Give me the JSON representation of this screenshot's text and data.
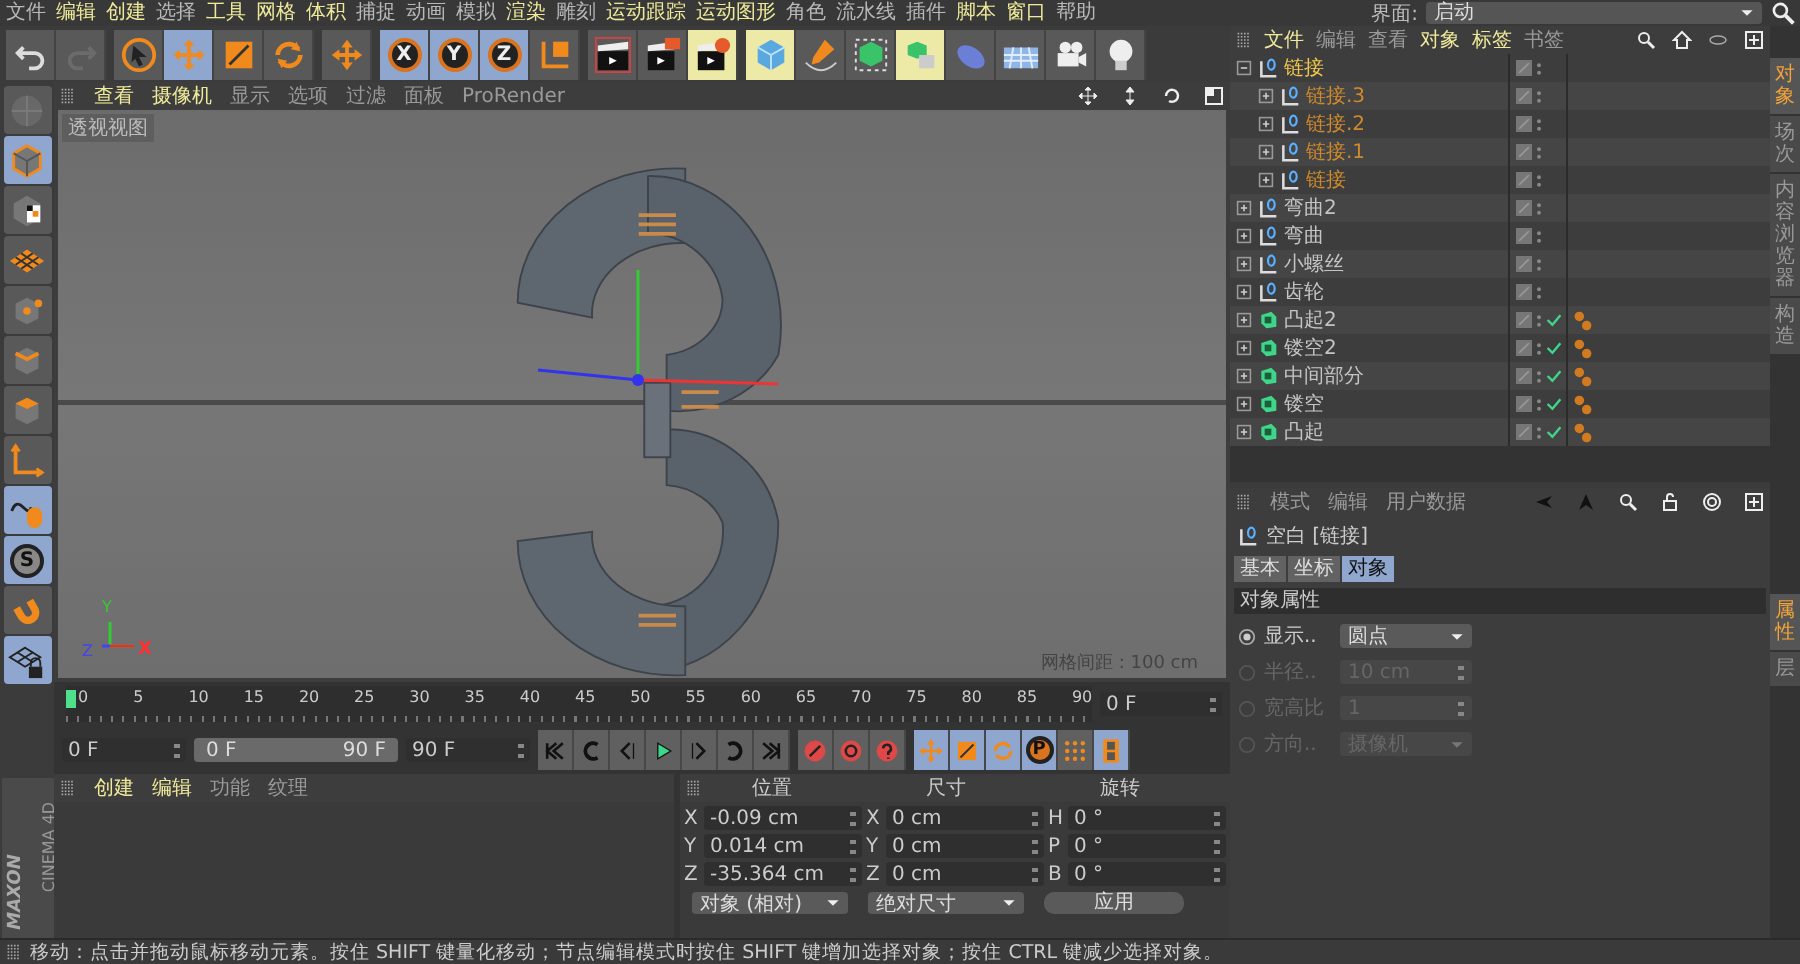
{
  "menu_bar": {
    "items": [
      {
        "label": "文件",
        "highlighted": false
      },
      {
        "label": "编辑",
        "highlighted": true
      },
      {
        "label": "创建",
        "highlighted": true
      },
      {
        "label": "选择",
        "highlighted": false
      },
      {
        "label": "工具",
        "highlighted": true
      },
      {
        "label": "网格",
        "highlighted": true
      },
      {
        "label": "体积",
        "highlighted": true
      },
      {
        "label": "捕捉",
        "highlighted": false
      },
      {
        "label": "动画",
        "highlighted": false
      },
      {
        "label": "模拟",
        "highlighted": false
      },
      {
        "label": "渲染",
        "highlighted": true
      },
      {
        "label": "雕刻",
        "highlighted": false
      },
      {
        "label": "运动跟踪",
        "highlighted": true
      },
      {
        "label": "运动图形",
        "highlighted": true
      },
      {
        "label": "角色",
        "highlighted": false
      },
      {
        "label": "流水线",
        "highlighted": false
      },
      {
        "label": "插件",
        "highlighted": false
      },
      {
        "label": "脚本",
        "highlighted": true
      },
      {
        "label": "窗口",
        "highlighted": true
      },
      {
        "label": "帮助",
        "highlighted": false
      }
    ],
    "interface_label": "界面:",
    "interface_value": "启动"
  },
  "toolbar": {
    "tools": [
      {
        "selected": false,
        "highlighted": false,
        "disabled": false
      },
      {
        "selected": false,
        "highlighted": false,
        "disabled": true
      },
      {
        "selected": false,
        "highlighted": false,
        "disabled": false
      },
      {
        "selected": true,
        "highlighted": false,
        "disabled": false
      },
      {
        "selected": false,
        "highlighted": false,
        "disabled": false
      },
      {
        "selected": false,
        "highlighted": false,
        "disabled": false
      },
      {
        "selected": false,
        "highlighted": false,
        "disabled": false
      },
      {
        "label": "X",
        "selected": true,
        "highlighted": false,
        "disabled": false
      },
      {
        "label": "Y",
        "selected": true,
        "highlighted": false,
        "disabled": false
      },
      {
        "label": "Z",
        "selected": true,
        "highlighted": false,
        "disabled": false
      },
      {
        "selected": false,
        "highlighted": false,
        "disabled": false
      },
      {
        "selected": false,
        "highlighted": false,
        "disabled": false
      },
      {
        "selected": false,
        "highlighted": false,
        "disabled": false
      },
      {
        "selected": false,
        "highlighted": true,
        "disabled": false
      },
      {
        "selected": false,
        "highlighted": true,
        "disabled": false
      },
      {
        "selected": false,
        "highlighted": false,
        "disabled": false
      },
      {
        "selected": false,
        "highlighted": false,
        "disabled": false
      },
      {
        "selected": false,
        "highlighted": true,
        "disabled": false
      },
      {
        "selected": false,
        "highlighted": false,
        "disabled": false
      },
      {
        "selected": false,
        "highlighted": false,
        "disabled": false
      },
      {
        "selected": false,
        "highlighted": false,
        "disabled": false
      },
      {
        "selected": false,
        "highlighted": false,
        "disabled": false
      }
    ]
  },
  "left_tools": [
    {
      "selected": false,
      "disabled": true
    },
    {
      "selected": true,
      "disabled": false
    },
    {
      "selected": false,
      "disabled": false
    },
    {
      "selected": false,
      "disabled": false
    },
    {
      "selected": false,
      "disabled": false
    },
    {
      "selected": false,
      "disabled": false
    },
    {
      "selected": false,
      "disabled": false
    },
    {
      "selected": false,
      "disabled": false
    },
    {
      "selected": true,
      "disabled": false
    },
    {
      "label": "S",
      "selected": true,
      "disabled": false
    },
    {
      "selected": false,
      "disabled": false
    },
    {
      "selected": true,
      "disabled": false
    }
  ],
  "viewport": {
    "menu": [
      {
        "label": "查看",
        "highlighted": true
      },
      {
        "label": "摄像机",
        "highlighted": true
      },
      {
        "label": "显示",
        "highlighted": false
      },
      {
        "label": "选项",
        "highlighted": false
      },
      {
        "label": "过滤",
        "highlighted": false
      },
      {
        "label": "面板",
        "highlighted": false
      },
      {
        "label": "ProRender",
        "highlighted": false
      }
    ],
    "view_name": "透视视图",
    "grid_info": "网格间距 : 100 cm",
    "axis_gizmo": {
      "x": "X",
      "y": "Y",
      "z": "Z"
    }
  },
  "timeline": {
    "ticks": [
      "0",
      "5",
      "10",
      "15",
      "20",
      "25",
      "30",
      "35",
      "40",
      "45",
      "50",
      "55",
      "60",
      "65",
      "70",
      "75",
      "80",
      "85",
      "90"
    ],
    "current_frame": "0 F"
  },
  "playback": {
    "start": "0 F",
    "range_start": "0 F",
    "range_end": "90 F",
    "level": 1,
    "end": "90 F",
    "key_tools": [
      {
        "selected": true
      },
      {
        "selected": true
      },
      {
        "selected": true
      },
      {
        "label": "P",
        "selected": true
      },
      {
        "selected": false
      },
      {
        "selected": true
      }
    ]
  },
  "material_panel": {
    "menu": [
      {
        "label": "创建",
        "highlighted": true
      },
      {
        "label": "编辑",
        "highlighted": true
      },
      {
        "label": "功能",
        "highlighted": false
      },
      {
        "label": "纹理",
        "highlighted": false
      }
    ]
  },
  "coordinates": {
    "headers": [
      "位置",
      "尺寸",
      "旋转"
    ],
    "rows": [
      {
        "position_axis": "X",
        "position": "-0.09 cm",
        "size_axis": "X",
        "size": "0 cm",
        "rotation_axis": "H",
        "rotation": "0 °"
      },
      {
        "position_axis": "Y",
        "position": "0.014 cm",
        "size_axis": "Y",
        "size": "0 cm",
        "rotation_axis": "P",
        "rotation": "0 °"
      },
      {
        "position_axis": "Z",
        "position": "-35.364 cm",
        "size_axis": "Z",
        "size": "0 cm",
        "rotation_axis": "B",
        "rotation": "0 °"
      }
    ],
    "mode": "对象 (相对)",
    "size_mode": "绝对尺寸",
    "apply": "应用"
  },
  "logo": {
    "brand": "MAXON",
    "product": "CINEMA 4D"
  },
  "object_manager": {
    "menu": [
      {
        "label": "文件",
        "highlighted": true
      },
      {
        "label": "编辑",
        "highlighted": false
      },
      {
        "label": "查看",
        "highlighted": false
      },
      {
        "label": "对象",
        "highlighted": true
      },
      {
        "label": "标签",
        "highlighted": true
      },
      {
        "label": "书签",
        "highlighted": false
      }
    ],
    "objects": [
      {
        "name": "链接",
        "kind": "null",
        "selected": true,
        "expanded": true,
        "children": [
          {
            "name": "链接.3",
            "kind": "null",
            "selected": false,
            "expanded": false
          },
          {
            "name": "链接.2",
            "kind": "null",
            "selected": false,
            "expanded": false
          },
          {
            "name": "链接.1",
            "kind": "null",
            "selected": false,
            "expanded": false
          },
          {
            "name": "链接",
            "kind": "null",
            "selected": false,
            "expanded": false
          }
        ]
      },
      {
        "name": "弯曲2",
        "kind": "null",
        "selected": false,
        "expanded": false
      },
      {
        "name": "弯曲",
        "kind": "null",
        "selected": false,
        "expanded": false
      },
      {
        "name": "小螺丝",
        "kind": "null",
        "selected": false,
        "expanded": false
      },
      {
        "name": "齿轮",
        "kind": "null",
        "selected": false,
        "expanded": false
      },
      {
        "name": "凸起2",
        "kind": "extrude",
        "selected": false,
        "expanded": false
      },
      {
        "name": "镂空2",
        "kind": "extrude",
        "selected": false,
        "expanded": false
      },
      {
        "name": "中间部分",
        "kind": "extrude",
        "selected": false,
        "expanded": false
      },
      {
        "name": "镂空",
        "kind": "extrude",
        "selected": false,
        "expanded": false
      },
      {
        "name": "凸起",
        "kind": "extrude",
        "selected": false,
        "expanded": false
      }
    ]
  },
  "side_tabs_top": [
    {
      "label": "对象",
      "selected": true
    },
    {
      "label": "场次",
      "selected": false
    },
    {
      "label": "内容浏览器",
      "selected": false
    },
    {
      "label": "构造",
      "selected": false
    }
  ],
  "attribute_manager": {
    "menu": [
      {
        "label": "模式",
        "highlighted": false
      },
      {
        "label": "编辑",
        "highlighted": false
      },
      {
        "label": "用户数据",
        "highlighted": false
      }
    ],
    "object_title": "空白 [链接]",
    "tabs": [
      {
        "label": "基本",
        "selected": false
      },
      {
        "label": "坐标",
        "selected": false
      },
      {
        "label": "对象",
        "selected": true
      }
    ],
    "section": "对象属性",
    "fields": [
      {
        "label": "显示..",
        "value": "圆点",
        "kind": "dropdown",
        "disabled": false
      },
      {
        "label": "半径..",
        "value": "10 cm",
        "kind": "spinner",
        "disabled": true
      },
      {
        "label": "宽高比",
        "value": "1",
        "kind": "spinner",
        "disabled": true
      },
      {
        "label": "方向..",
        "value": "摄像机",
        "kind": "dropdown",
        "disabled": true
      }
    ]
  },
  "side_tabs_bottom": [
    {
      "label": "属性",
      "selected": true
    },
    {
      "label": "层",
      "selected": false
    }
  ],
  "status_bar": "移动：点击并拖动鼠标移动元素。按住 SHIFT 键量化移动；节点编辑模式时按住 SHIFT 键增加选择对象；按住 CTRL 键减少选择对象。"
}
